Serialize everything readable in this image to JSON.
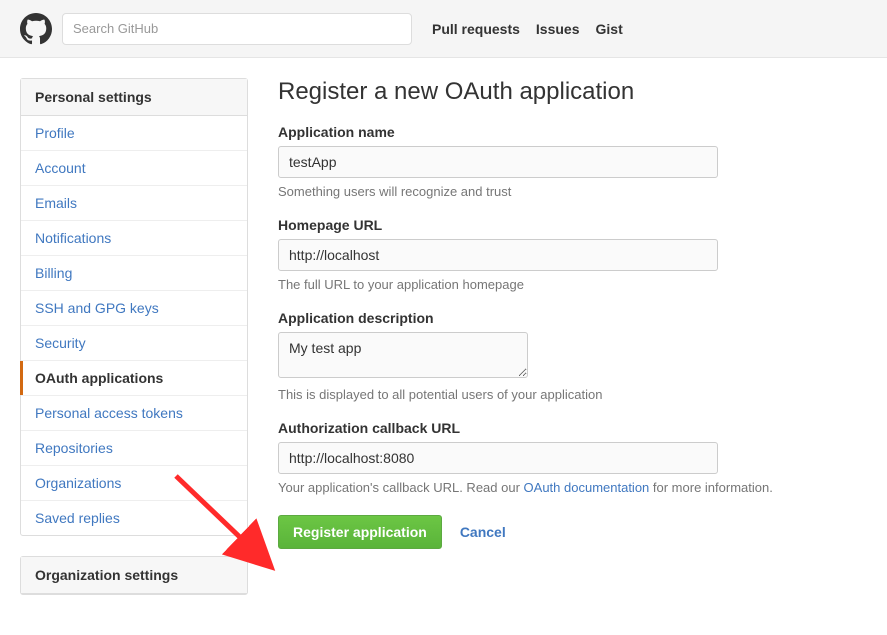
{
  "topnav": {
    "search_placeholder": "Search GitHub",
    "links": [
      "Pull requests",
      "Issues",
      "Gist"
    ]
  },
  "sidebar": {
    "groups": [
      {
        "header": "Personal settings",
        "items": [
          {
            "label": "Profile",
            "active": false
          },
          {
            "label": "Account",
            "active": false
          },
          {
            "label": "Emails",
            "active": false
          },
          {
            "label": "Notifications",
            "active": false
          },
          {
            "label": "Billing",
            "active": false
          },
          {
            "label": "SSH and GPG keys",
            "active": false
          },
          {
            "label": "Security",
            "active": false
          },
          {
            "label": "OAuth applications",
            "active": true
          },
          {
            "label": "Personal access tokens",
            "active": false
          },
          {
            "label": "Repositories",
            "active": false
          },
          {
            "label": "Organizations",
            "active": false
          },
          {
            "label": "Saved replies",
            "active": false
          }
        ]
      },
      {
        "header": "Organization settings",
        "items": []
      }
    ]
  },
  "main": {
    "title": "Register a new OAuth application",
    "fields": {
      "appname": {
        "label": "Application name",
        "value": "testApp",
        "hint": "Something users will recognize and trust"
      },
      "homepage": {
        "label": "Homepage URL",
        "value": "http://localhost",
        "hint": "The full URL to your application homepage"
      },
      "description": {
        "label": "Application description",
        "value": "My test app",
        "hint": "This is displayed to all potential users of your application"
      },
      "callback": {
        "label": "Authorization callback URL",
        "value": "http://localhost:8080",
        "hint_before": "Your application's callback URL. Read our ",
        "hint_link": "OAuth documentation",
        "hint_after": " for more information."
      }
    },
    "actions": {
      "submit": "Register application",
      "cancel": "Cancel"
    }
  },
  "annotation": {
    "arrow_color": "#ff2a2a"
  }
}
